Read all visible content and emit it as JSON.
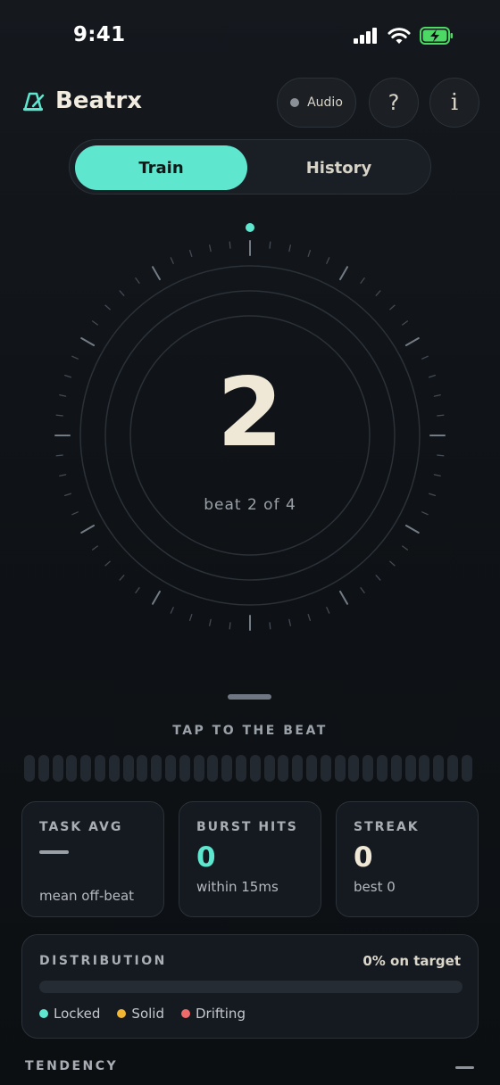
{
  "status": {
    "time": "9:41"
  },
  "header": {
    "app_name": "Beatrx",
    "audio_label": "Audio",
    "help_label": "?",
    "info_label": "i"
  },
  "tabs": [
    {
      "label": "Train",
      "active": true
    },
    {
      "label": "History",
      "active": false
    }
  ],
  "dial": {
    "beat": "2",
    "caption": "beat 2 of 4"
  },
  "tap": {
    "label": "TAP TO THE BEAT",
    "segment_count": 32
  },
  "stats": [
    {
      "title": "TASK AVG",
      "value": "",
      "sub": "mean off-beat"
    },
    {
      "title": "BURST HITS",
      "value": "0",
      "sub": "within 15ms"
    },
    {
      "title": "STREAK",
      "value": "0",
      "sub": "best 0"
    }
  ],
  "distribution": {
    "title": "DISTRIBUTION",
    "on_target": "0% on target",
    "legend": [
      {
        "label": "Locked",
        "color": "#5ee6cf"
      },
      {
        "label": "Solid",
        "color": "#f2b632"
      },
      {
        "label": "Drifting",
        "color": "#ef6a6a"
      }
    ]
  },
  "tendency": {
    "title": "TENDENCY"
  },
  "colors": {
    "accent": "#5ee6cf",
    "cream": "#efe8d6"
  }
}
